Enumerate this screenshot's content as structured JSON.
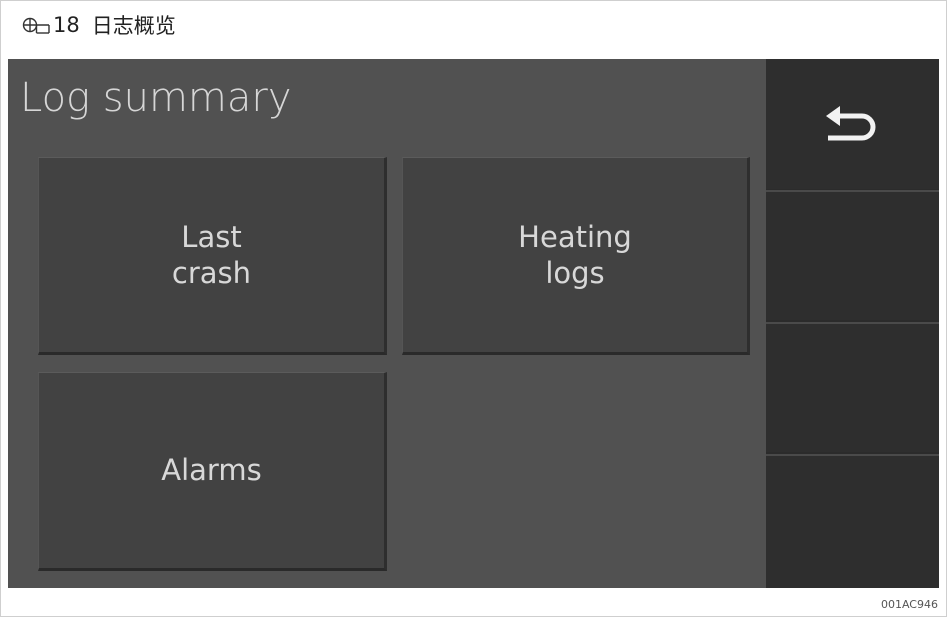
{
  "figure": {
    "number": "18",
    "title": "日志概览",
    "code": "001AC946"
  },
  "screen": {
    "title": "Log summary",
    "tiles": [
      {
        "line1": "Last",
        "line2": "crash"
      },
      {
        "line1": "Heating",
        "line2": "logs"
      },
      {
        "line1": "Alarms",
        "line2": ""
      }
    ],
    "sidebar": {
      "buttons": [
        {
          "icon": "back-arrow-icon"
        },
        {
          "icon": ""
        },
        {
          "icon": ""
        },
        {
          "icon": ""
        }
      ]
    }
  },
  "colors": {
    "screen_bg": "#515151",
    "tile_bg": "#424242",
    "sidebar_bg": "#2b2b2b",
    "text": "#d8d8d8"
  }
}
